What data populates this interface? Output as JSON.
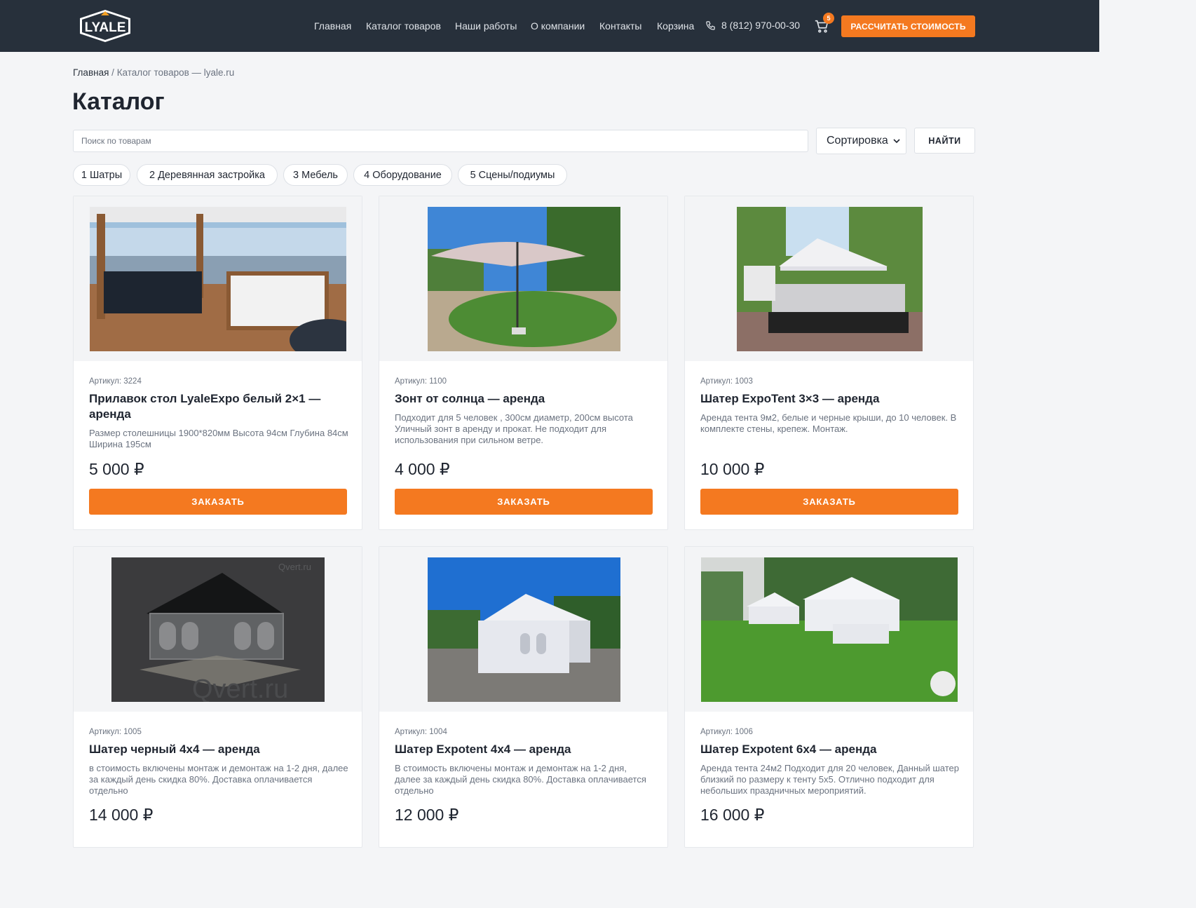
{
  "header": {
    "logo_text": "LYALE",
    "nav": [
      "Главная",
      "Каталог товаров",
      "Наши работы",
      "О компании",
      "Контакты",
      "Корзина"
    ],
    "phone": "8 (812) 970-00-30",
    "cart_count": "5",
    "cta_label": "РАССЧИТАТЬ СТОИМОСТЬ"
  },
  "breadcrumb": {
    "home": "Главная",
    "separator": "/",
    "current": "Каталог товаров — lyale.ru"
  },
  "page_title": "Каталог",
  "search": {
    "placeholder": "Поиск по товарам",
    "sort_label": "Сортировка",
    "find_label": "НАЙТИ"
  },
  "categories": [
    "1 Шатры",
    "2 Деревянная застройка",
    "3 Мебель",
    "4 Оборудование",
    "5 Сцены/подиумы"
  ],
  "colors": {
    "header_bg": "#27303b",
    "accent": "#f47920",
    "page_bg": "#f4f5f7"
  },
  "products": [
    {
      "sku": "Артикул: 3224",
      "name": "Прилавок стол LyaleExpo белый 2×1 — аренда",
      "desc": "Размер столешницы 1900*820мм Высота 94см Глубина 84см Ширина 195см",
      "price": "5 000 ₽",
      "button": "ЗАКАЗАТЬ"
    },
    {
      "sku": "Артикул: 1100",
      "name": "Зонт от солнца — аренда",
      "desc": "Подходит для 5 человек , 300см диаметр, 200см высота Уличный зонт в аренду и прокат. Не подходит для использования при сильном ветре.",
      "price": "4 000 ₽",
      "button": "ЗАКАЗАТЬ"
    },
    {
      "sku": "Артикул: 1003",
      "name": "Шатер ExpoTent 3×3 — аренда",
      "desc": "Аренда тента 9м2, белые и черные крыши, до 10 человек. В комплекте стены, крепеж. Монтаж.",
      "price": "10 000 ₽",
      "button": "ЗАКАЗАТЬ"
    },
    {
      "sku": "Артикул: 1005",
      "name": "Шатер черный 4х4 — аренда",
      "desc": "в стоимость включены монтаж и демонтаж на 1-2 дня, далее за каждый день скидка 80%. Доставка оплачивается отдельно",
      "price": "14 000 ₽",
      "watermark": "Qvert.ru"
    },
    {
      "sku": "Артикул: 1004",
      "name": "Шатер Expotent 4х4 — аренда",
      "desc": "В стоимость включены монтаж и демонтаж на 1-2 дня, далее за каждый день скидка 80%. Доставка оплачивается отдельно",
      "price": "12 000 ₽"
    },
    {
      "sku": "Артикул: 1006",
      "name": "Шатер Expotent 6х4 — аренда",
      "desc": "Аренда тента 24м2 Подходит для 20 человек, Данный шатер близкий по размеру к тенту 5х5. Отлично подходит для небольших праздничных мероприятий.",
      "price": "16 000 ₽"
    }
  ]
}
